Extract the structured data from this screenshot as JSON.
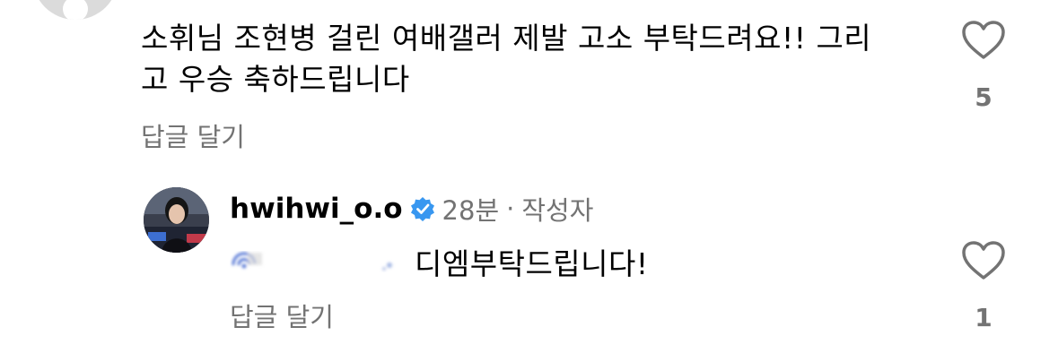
{
  "comment": {
    "text": "소휘님 조현병 걸린 여배갤러 제발 고소 부탁드려요!! 그리고 우승 축하드립니다",
    "reply_label": "답글 달기",
    "like_count": "5"
  },
  "reply": {
    "username": "hwihwi_o.o",
    "time": "28분",
    "separator": "·",
    "author_tag": "작성자",
    "text": "디엠부탁드립니다!",
    "reply_label": "답글 달기",
    "like_count": "1"
  },
  "colors": {
    "secondary_text": "#737373",
    "verified_badge": "#3897f0"
  }
}
